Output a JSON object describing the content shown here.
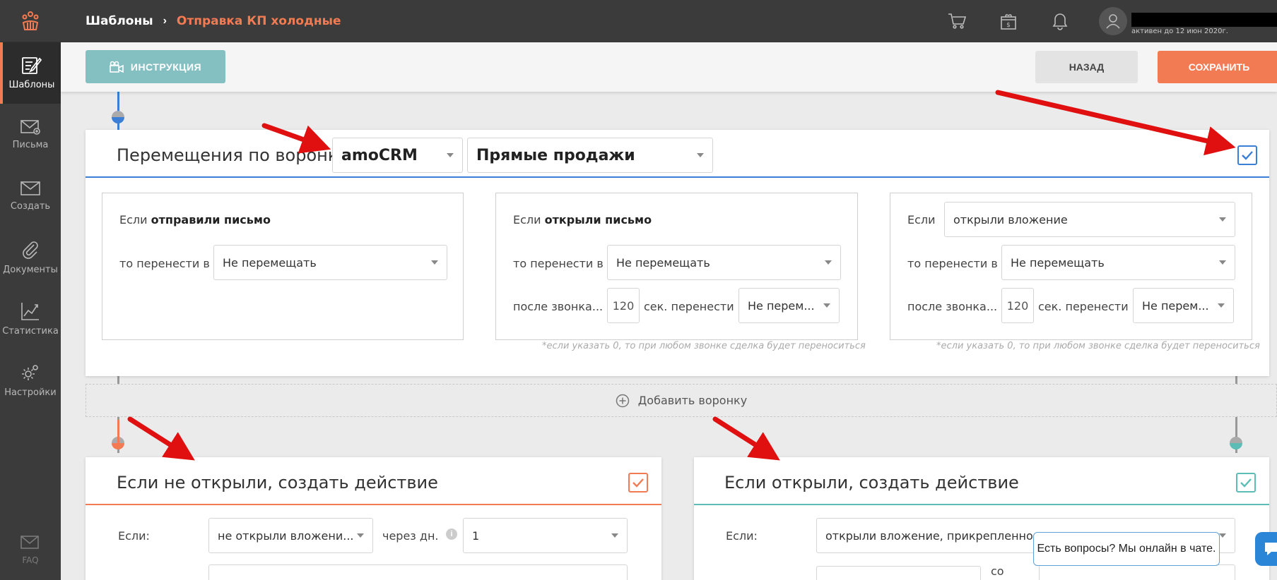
{
  "sidebar": {
    "items": [
      {
        "label": "Шаблоны",
        "icon": "templates-icon"
      },
      {
        "label": "Письма",
        "icon": "letters-icon"
      },
      {
        "label": "Создать",
        "icon": "create-icon"
      },
      {
        "label": "Документы",
        "icon": "paperclip-icon"
      },
      {
        "label": "Статистика",
        "icon": "chart-icon"
      },
      {
        "label": "Настройки",
        "icon": "gear-icon"
      }
    ],
    "faq_label": "FAQ"
  },
  "header": {
    "breadcrumb_root": "Шаблоны",
    "breadcrumb_sep": "›",
    "breadcrumb_current": "Отправка КП холодные",
    "user_status": "активен до 12 июн 2020г."
  },
  "toolbar": {
    "instruction_label": "ИНСТРУКЦИЯ",
    "back_label": "НАЗАД",
    "save_label": "СОХРАНИТЬ"
  },
  "funnel_card": {
    "title": "Перемещения по воронке",
    "crm_select": "amoCRM",
    "pipeline_select": "Прямые продажи",
    "rules": [
      {
        "if_prefix": "Если ",
        "if_bold": "отправили письмо",
        "move_label": "то перенести в",
        "move_value": "Не перемещать"
      },
      {
        "if_prefix": "Если ",
        "if_bold": "открыли письмо",
        "move_label": "то перенести в",
        "move_value": "Не перемещать",
        "call_label": "после звонка...",
        "call_seconds": "120",
        "call_move_label": "сек. перенести в",
        "call_move_value": "Не перем...",
        "note": "*если указать 0, то при любом звонке сделка будет переноситься"
      },
      {
        "if_prefix": "Если",
        "if_select": "открыли вложение",
        "move_label": "то перенести в",
        "move_value": "Не перемещать",
        "call_label": "после звонка...",
        "call_seconds": "120",
        "call_move_label": "сек. перенести в",
        "call_move_value": "Не перем...",
        "note": "*если указать 0, то при любом звонке сделка будет переноситься"
      }
    ]
  },
  "add_funnel_label": "Добавить воронку",
  "action_not_opened": {
    "title": "Если не открыли, создать действие",
    "if_label": "Если:",
    "if_value": "не открыли вложени...",
    "after_days_label": "через дн.",
    "days_value": "1"
  },
  "action_opened": {
    "title": "Если открыли, создать действие",
    "if_label": "Если:",
    "if_value": "открыли вложение, прикрепленное п",
    "partial_label": "со"
  },
  "chat": {
    "bubble_text": "Есть вопросы? Мы онлайн в чате."
  },
  "colors": {
    "accent_orange": "#f27b53",
    "accent_blue": "#3a7fd5",
    "accent_teal": "#5bbdb5",
    "sidebar_bg": "#3b3b3b",
    "annotation_red": "#e01010"
  }
}
